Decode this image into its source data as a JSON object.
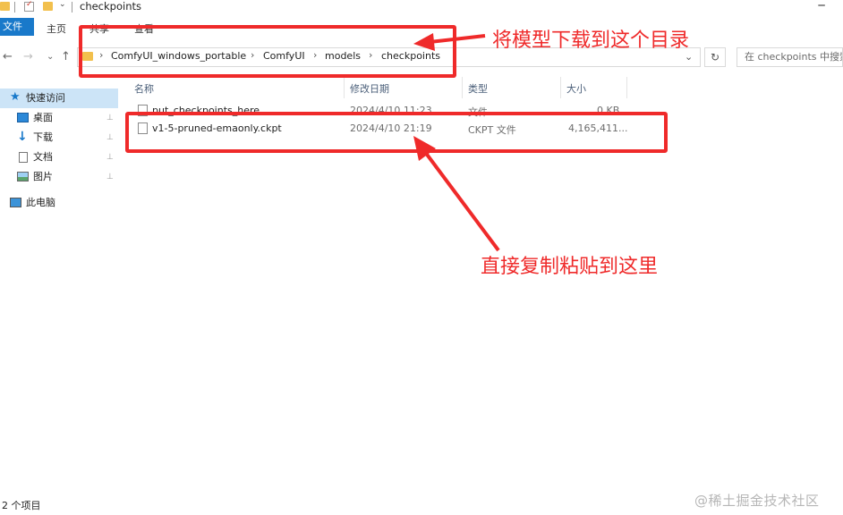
{
  "window": {
    "title": "checkpoints",
    "minimize_glyph": "─"
  },
  "ribbon": {
    "tabs": [
      "文件",
      "主页",
      "共享",
      "查看"
    ]
  },
  "nav_buttons": {
    "back": "←",
    "forward": "→",
    "dropdown": "⌄",
    "up": "↑"
  },
  "address": {
    "breadcrumb": [
      "ComfyUI_windows_portable",
      "ComfyUI",
      "models",
      "checkpoints"
    ],
    "separator": "›",
    "dropdown": "⌄",
    "refresh": "↻"
  },
  "search": {
    "placeholder": "在 checkpoints 中搜索"
  },
  "sidebar": {
    "quick_access": "快速访问",
    "items": [
      {
        "label": "桌面",
        "icon": "desktop-icon"
      },
      {
        "label": "下载",
        "icon": "download-icon"
      },
      {
        "label": "文档",
        "icon": "document-icon"
      },
      {
        "label": "图片",
        "icon": "picture-icon"
      }
    ],
    "this_pc": "此电脑",
    "pin_glyph": "📌"
  },
  "columns": [
    "名称",
    "修改日期",
    "类型",
    "大小"
  ],
  "files": [
    {
      "name": "put_checkpoints_here",
      "date": "2024/4/10 11:23",
      "type": "文件",
      "size": "0 KB"
    },
    {
      "name": "v1-5-pruned-emaonly.ckpt",
      "date": "2024/4/10 21:19",
      "type": "CKPT 文件",
      "size": "4,165,411..."
    }
  ],
  "status": {
    "item_count": "2 个项目"
  },
  "annotations": {
    "top": "将模型下载到这个目录",
    "middle": "直接复制粘贴到这里",
    "color": "#ef2a2a"
  },
  "watermark": "@稀土掘金技术社区",
  "colors": {
    "accent": "#1979ca",
    "folder": "#f2c04d"
  }
}
